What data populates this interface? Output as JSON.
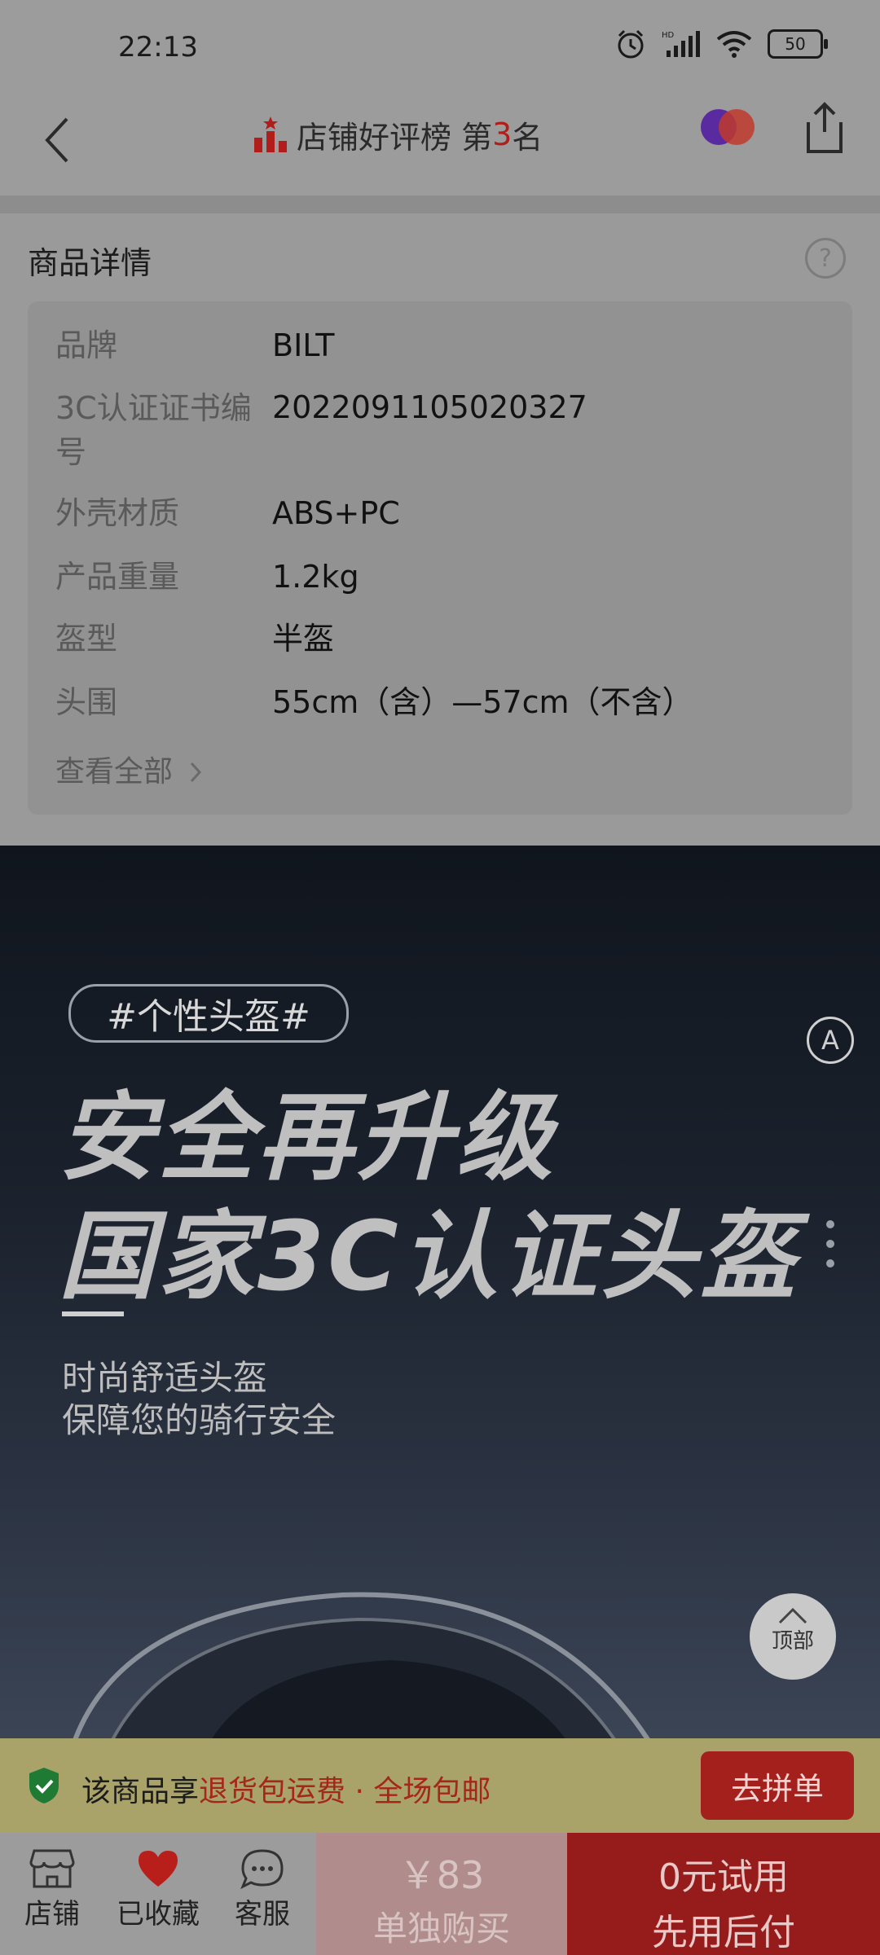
{
  "status_bar": {
    "time": "22:13",
    "battery": "50"
  },
  "nav": {
    "title_prefix": "店铺好评榜 第",
    "rank": "3",
    "title_suffix": "名"
  },
  "details": {
    "title": "商品详情",
    "rows": [
      {
        "key": "品牌",
        "value": "BILT"
      },
      {
        "key": "3C认证证书编号",
        "value": "2022091105020327"
      },
      {
        "key": "外壳材质",
        "value": "ABS+PC"
      },
      {
        "key": "产品重量",
        "value": "1.2kg"
      },
      {
        "key": "盔型",
        "value": "半盔"
      },
      {
        "key": "头围",
        "value": "55cm（含）—57cm（不含）"
      }
    ],
    "view_all": "查看全部",
    "help": "?"
  },
  "banner": {
    "tag": "#个性头盔#",
    "headline1": "安全再升级",
    "headline2": "国家3C认证头盔",
    "sub1": "时尚舒适头盔",
    "sub2": "保障您的骑行安全",
    "a_icon": "A"
  },
  "top_button": "顶部",
  "promo": {
    "prefix": "该商品享",
    "highlight": "退货包运费 · 全场包邮",
    "group_button": "去拼单"
  },
  "bottom_bar": {
    "store": "店铺",
    "favorited": "已收藏",
    "service": "客服",
    "single_price": "￥83",
    "single_label": "单独购买",
    "later_line1": "0元试用",
    "later_line2": "先用后付"
  },
  "colors": {
    "accent_red": "#b11d1a",
    "promo_red": "#a5261a",
    "shield_green": "#1f7a33"
  }
}
